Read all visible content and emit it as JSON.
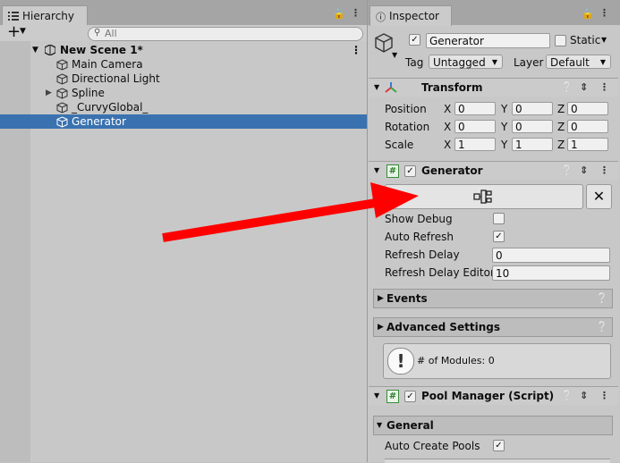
{
  "hierarchy": {
    "tab_label": "Hierarchy",
    "search_placeholder": "All",
    "scene_name": "New Scene 1*",
    "items": [
      {
        "label": "Main Camera"
      },
      {
        "label": "Directional Light"
      },
      {
        "label": "Spline"
      },
      {
        "label": "_CurvyGlobal_"
      },
      {
        "label": "Generator"
      }
    ]
  },
  "inspector": {
    "tab_label": "Inspector",
    "object_name": "Generator",
    "static_label": "Static",
    "tag_label": "Tag",
    "tag_value": "Untagged",
    "layer_label": "Layer",
    "layer_value": "Default",
    "transform": {
      "title": "Transform",
      "rows": [
        {
          "label": "Position",
          "x": "0",
          "y": "0",
          "z": "0"
        },
        {
          "label": "Rotation",
          "x": "0",
          "y": "0",
          "z": "0"
        },
        {
          "label": "Scale",
          "x": "1",
          "y": "1",
          "z": "1"
        }
      ],
      "axis_x": "X",
      "axis_y": "Y",
      "axis_z": "Z"
    },
    "generator": {
      "title": "Generator",
      "close_label": "✕",
      "show_debug_label": "Show Debug",
      "auto_refresh_label": "Auto Refresh",
      "refresh_delay_label": "Refresh Delay",
      "refresh_delay_value": "0",
      "refresh_delay_editor_label": "Refresh Delay Editor",
      "refresh_delay_editor_value": "10",
      "events_label": "Events",
      "advanced_label": "Advanced Settings",
      "modules_text": "# of Modules: 0"
    },
    "pool_manager": {
      "title": "Pool Manager (Script)",
      "general_label": "General",
      "auto_create_pools_label": "Auto Create Pools"
    }
  },
  "colors": {
    "selection": "#3a72b0",
    "arrow": "#ff0000",
    "panel_bg": "#c8c8c8"
  }
}
